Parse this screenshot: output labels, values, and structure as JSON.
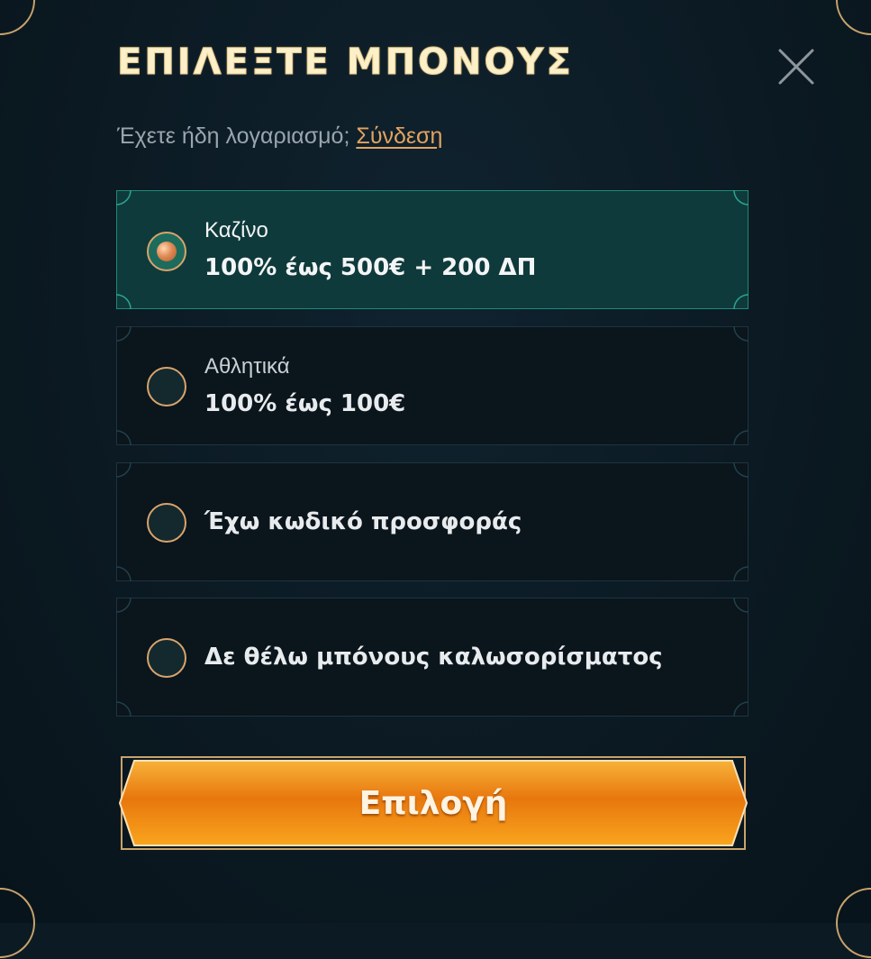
{
  "modal": {
    "title": "ΕΠΙΛΕΞΤΕ ΜΠΟΝΟΥΣ",
    "login_prompt": "Έχετε ήδη λογαριασμό;",
    "login_link": "Σύνδεση"
  },
  "options": [
    {
      "category": "Καζίνο",
      "offer": "100% έως 500€ + 200 ΔΠ",
      "selected": true
    },
    {
      "category": "Αθλητικά",
      "offer": "100% έως 100€",
      "selected": false
    },
    {
      "category": "",
      "offer": "Έχω κωδικό προσφοράς",
      "selected": false
    },
    {
      "category": "",
      "offer": "Δε θέλω μπόνους καλωσορίσματος",
      "selected": false
    }
  ],
  "cta": {
    "label": "Επιλογή"
  },
  "colors": {
    "background": "#0b1922",
    "selected_bg": "#0f3a3b",
    "selected_border": "#1f8a78",
    "accent": "#e3a35f",
    "cta_orange": "#f39a1f",
    "title": "#fbf0c9"
  },
  "icons": {
    "close": "close-icon",
    "radio": "radio-icon"
  }
}
